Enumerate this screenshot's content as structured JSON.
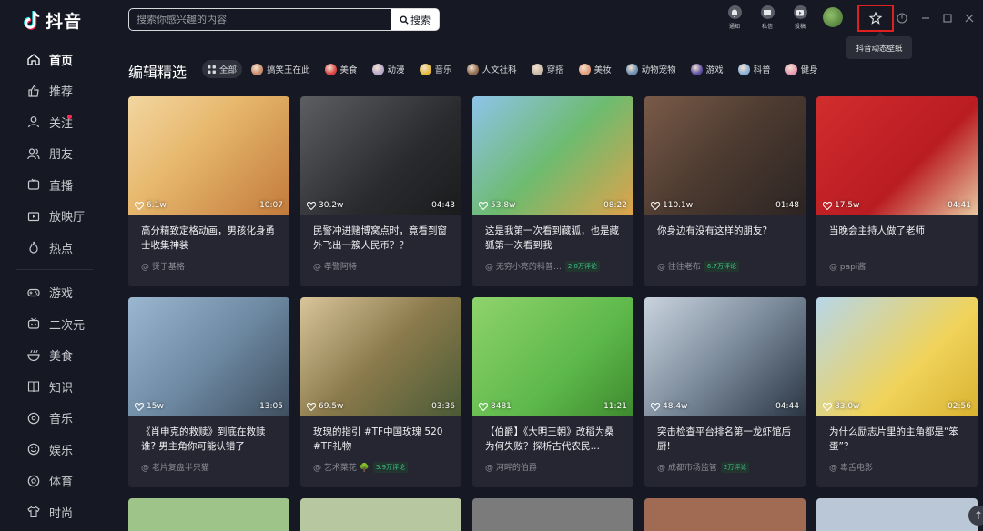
{
  "app": {
    "title": "抖音"
  },
  "sidebar": {
    "items": [
      {
        "label": "首页",
        "icon": "home-icon",
        "active": true
      },
      {
        "label": "推荐",
        "icon": "thumb-up-icon"
      },
      {
        "label": "关注",
        "icon": "person-icon",
        "dot": true
      },
      {
        "label": "朋友",
        "icon": "friends-icon"
      },
      {
        "label": "直播",
        "icon": "live-icon"
      },
      {
        "label": "放映厅",
        "icon": "cinema-icon"
      },
      {
        "label": "热点",
        "icon": "flame-icon"
      },
      {
        "label": "游戏",
        "icon": "gamepad-icon"
      },
      {
        "label": "二次元",
        "icon": "tv-icon"
      },
      {
        "label": "美食",
        "icon": "bowl-icon"
      },
      {
        "label": "知识",
        "icon": "book-icon"
      },
      {
        "label": "音乐",
        "icon": "music-icon"
      },
      {
        "label": "娱乐",
        "icon": "smile-icon"
      },
      {
        "label": "体育",
        "icon": "ball-icon"
      },
      {
        "label": "时尚",
        "icon": "shirt-icon"
      }
    ]
  },
  "search": {
    "placeholder": "搜索你感兴趣的内容",
    "button": "搜索"
  },
  "top_actions": [
    {
      "label": "通知",
      "icon": "bell-icon"
    },
    {
      "label": "私信",
      "icon": "message-icon"
    },
    {
      "label": "投稿",
      "icon": "upload-icon"
    }
  ],
  "wallpaper": {
    "tooltip": "抖音动态壁纸",
    "icon": "wallpaper-icon"
  },
  "heading": "编辑精选",
  "chips": [
    {
      "label": "全部",
      "active": true,
      "color": "#9aa0a6"
    },
    {
      "label": "搞笑王在此",
      "color": "#c98b6b"
    },
    {
      "label": "美食",
      "color": "#d94545"
    },
    {
      "label": "动漫",
      "color": "#b6a9c9"
    },
    {
      "label": "音乐",
      "color": "#e2b93d"
    },
    {
      "label": "人文社科",
      "color": "#8e6b4f"
    },
    {
      "label": "穿搭",
      "color": "#c7b7a6"
    },
    {
      "label": "美妆",
      "color": "#e29b7b"
    },
    {
      "label": "动物宠物",
      "color": "#6b8fb3"
    },
    {
      "label": "游戏",
      "color": "#5b4fa3"
    },
    {
      "label": "科普",
      "color": "#8ab0d8"
    },
    {
      "label": "健身",
      "color": "#e59ab0"
    }
  ],
  "videos": [
    {
      "title": "高分精致定格动画，男孩化身勇士收集神装",
      "author": "@ 贤于基格",
      "likes": "6.1w",
      "duration": "10:07",
      "badge": "",
      "bg": "linear-gradient(135deg,#f2d6a0 0%,#e7b86e 40%,#c27a3b 100%)"
    },
    {
      "title": "民警冲进赌博窝点时，竟看到窗外飞出一簇人民币？？",
      "author": "@ 孝警阿特",
      "likes": "30.2w",
      "duration": "04:43",
      "badge": "",
      "bg": "linear-gradient(135deg,#5c5e62 0%,#2a2b2e 60%,#1a1b1d 100%)"
    },
    {
      "title": "这是我第一次看到藏狐，也是藏狐第一次看到我",
      "author": "@ 无穷小亮的科普…",
      "likes": "53.8w",
      "duration": "08:22",
      "badge": "2.8万评论",
      "bg": "linear-gradient(135deg,#8ec3ea 0%,#6dbb6f 50%,#e0a24a 100%)"
    },
    {
      "title": "你身边有没有这样的朋友?",
      "author": "@ 往往老布",
      "likes": "110.1w",
      "duration": "01:48",
      "badge": "6.7万评论",
      "bg": "linear-gradient(135deg,#7a5a48 0%,#4b3a30 50%,#2c2422 100%)"
    },
    {
      "title": "当晚会主持人做了老师",
      "author": "@ papi酱",
      "likes": "17.5w",
      "duration": "04:41",
      "badge": "",
      "bg": "linear-gradient(135deg,#d12d2d 0%,#b91c22 60%,#e7c7a0 100%)"
    },
    {
      "title": "《肖申克的救赎》到底在救赎谁? 男主角你可能认错了",
      "author": "@ 老片复盘半只猫",
      "likes": "15w",
      "duration": "13:05",
      "badge": "",
      "bg": "linear-gradient(135deg,#9bb7d0 0%,#6f8ba4 50%,#3f4f60 100%)"
    },
    {
      "title": "玫瑰的指引 #TF中国玫瑰 520 #TF礼物",
      "author": "@ 艺术菜花 🌳",
      "likes": "69.5w",
      "duration": "03:36",
      "badge": "5.9万评论",
      "bg": "linear-gradient(135deg,#d8c59a 0%,#8a7a4b 50%,#4a5a36 100%)"
    },
    {
      "title": "【伯爵】《大明王朝》改稻为桑为何失败？探析古代农民…",
      "author": "@ 河畔的伯爵",
      "likes": "8481",
      "duration": "11:21",
      "badge": "",
      "bg": "linear-gradient(135deg,#8ed36b 0%,#5db84a 60%,#3e8a2f 100%)"
    },
    {
      "title": "突击检查平台排名第一龙虾馆后厨!",
      "author": "@ 成都市场监管",
      "likes": "48.4w",
      "duration": "04:44",
      "badge": "2万评论",
      "bg": "linear-gradient(135deg,#c9d3de 0%,#7b8a9a 50%,#2b3644 100%)"
    },
    {
      "title": "为什么励志片里的主角都是“笨蛋”？",
      "author": "@ 毒舌电影",
      "likes": "83.0w",
      "duration": "02:56",
      "badge": "",
      "bg": "linear-gradient(135deg,#b7d6e8 0%,#f0d35a 60%,#d9b230 100%)"
    }
  ],
  "row3_bgs": [
    "#9ec48a",
    "#b7c8a0",
    "#7b7b7b",
    "#a06b52",
    "#b9c7d6"
  ]
}
